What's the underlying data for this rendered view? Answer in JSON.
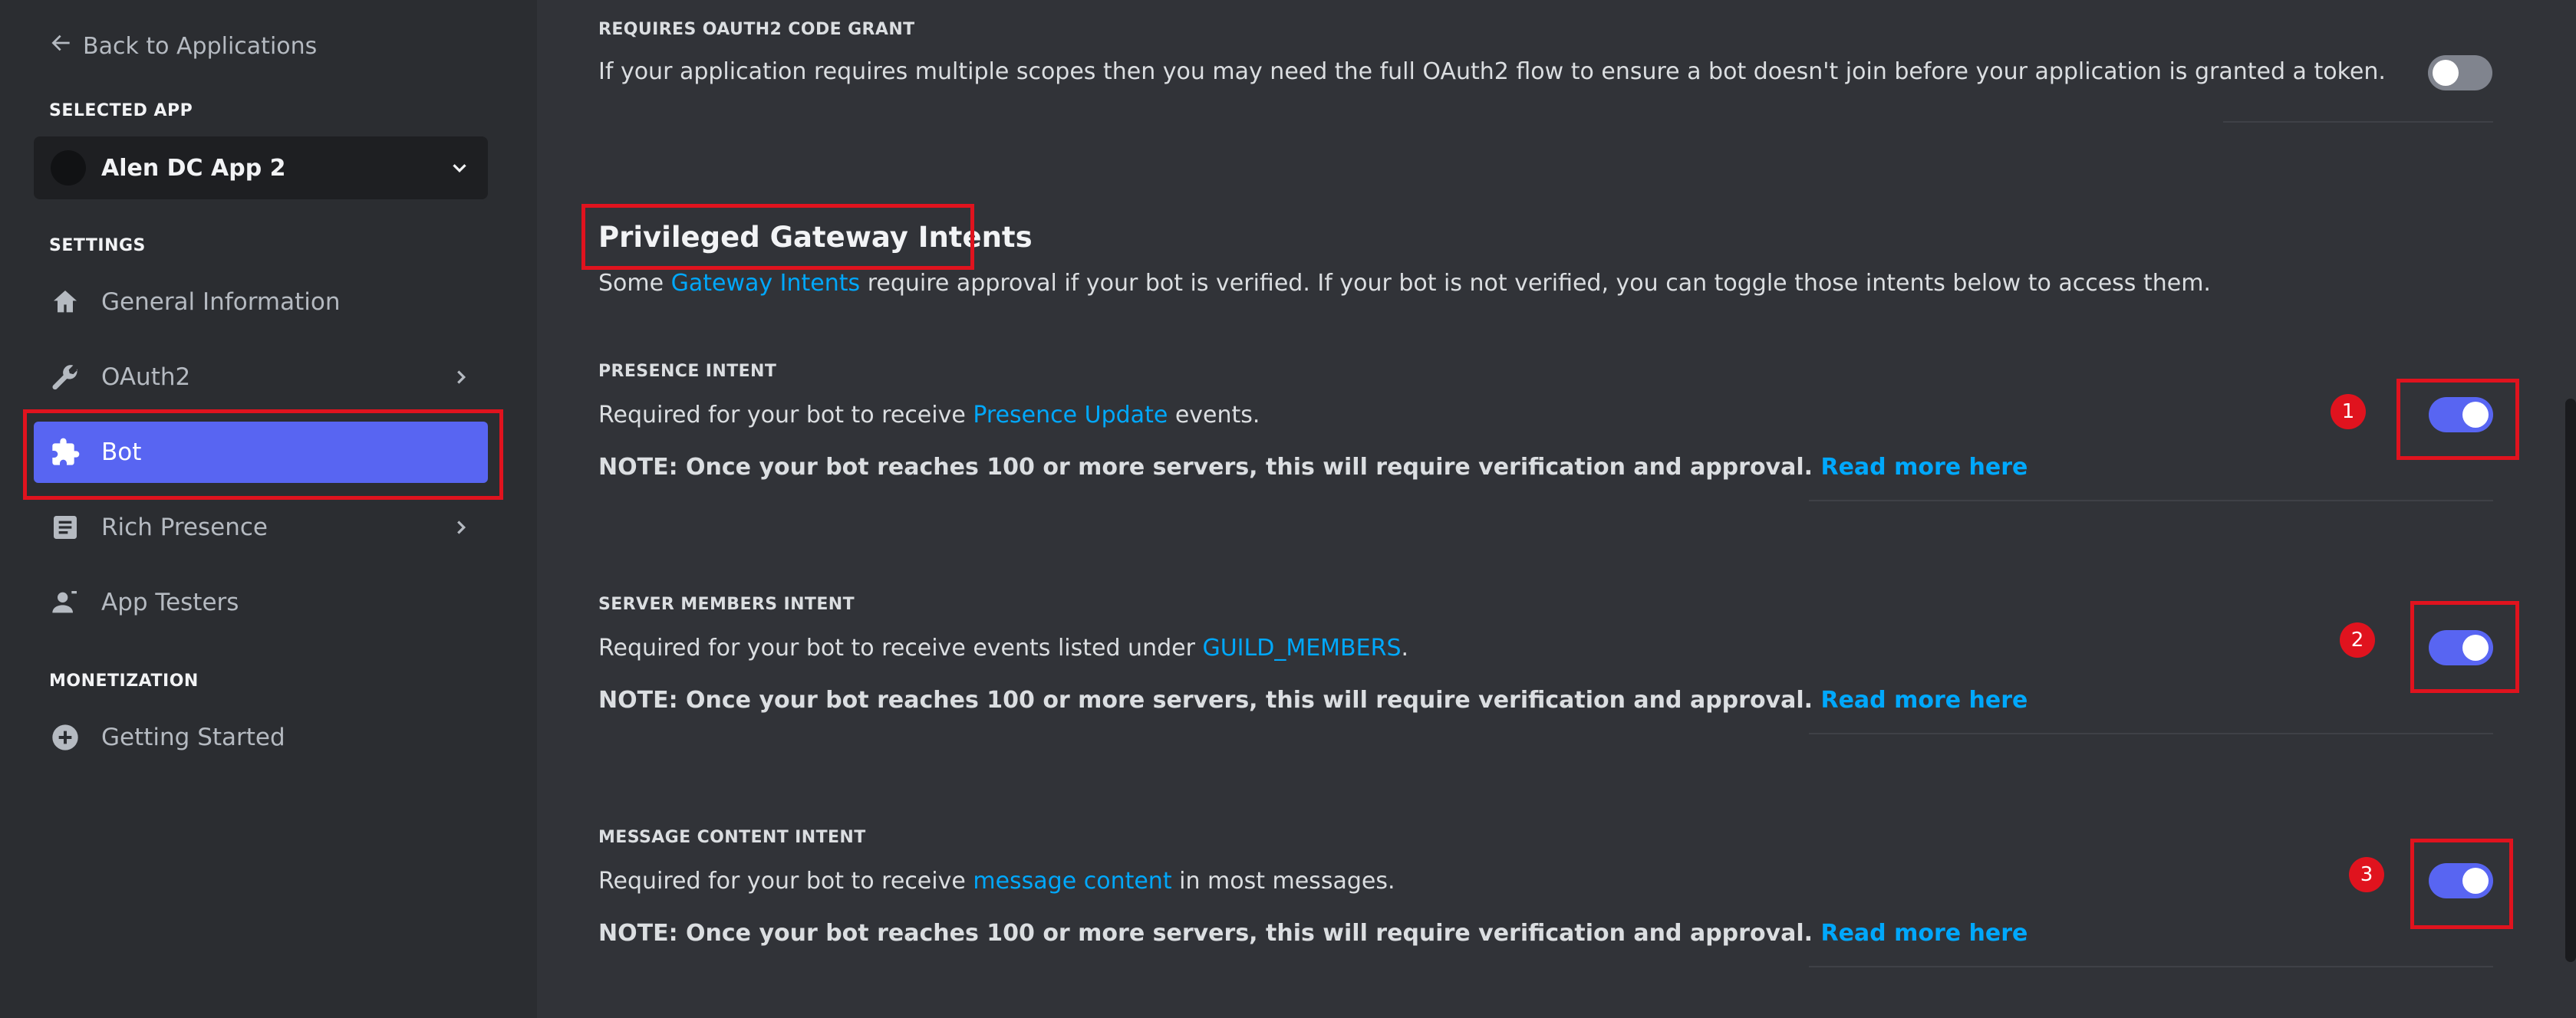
{
  "sidebar": {
    "back_label": "Back to Applications",
    "selected_app_label": "SELECTED APP",
    "app_name": "Alen DC App 2",
    "settings_label": "SETTINGS",
    "items": [
      {
        "label": "General Information",
        "icon": "home-icon"
      },
      {
        "label": "OAuth2",
        "icon": "wrench-icon"
      },
      {
        "label": "Bot",
        "icon": "puzzle-icon"
      },
      {
        "label": "Rich Presence",
        "icon": "document-icon"
      },
      {
        "label": "App Testers",
        "icon": "user-icon"
      }
    ],
    "monetization_label": "MONETIZATION",
    "monetization_items": [
      {
        "label": "Getting Started",
        "icon": "plus-circle-icon"
      }
    ]
  },
  "main": {
    "oauth_grant": {
      "title": "REQUIRES OAUTH2 CODE GRANT",
      "description": "If your application requires multiple scopes then you may need the full OAuth2 flow to ensure a bot doesn't join before your application is granted a token.",
      "enabled": false
    },
    "intents_section": {
      "heading": "Privileged Gateway Intents",
      "desc_prefix": "Some ",
      "desc_link": "Gateway Intents",
      "desc_suffix": " require approval if your bot is verified. If your bot is not verified, you can toggle those intents below to access them."
    },
    "intents": [
      {
        "title": "PRESENCE INTENT",
        "desc_prefix": "Required for your bot to receive ",
        "desc_link": "Presence Update",
        "desc_suffix": " events.",
        "note": "NOTE: Once your bot reaches 100 or more servers, this will require verification and approval.",
        "note_link": "Read more here",
        "enabled": true,
        "badge": "1"
      },
      {
        "title": "SERVER MEMBERS INTENT",
        "desc_prefix": "Required for your bot to receive events listed under ",
        "desc_link": "GUILD_MEMBERS",
        "desc_suffix": ".",
        "note": "NOTE: Once your bot reaches 100 or more servers, this will require verification and approval.",
        "note_link": "Read more here",
        "enabled": true,
        "badge": "2"
      },
      {
        "title": "MESSAGE CONTENT INTENT",
        "desc_prefix": "Required for your bot to receive ",
        "desc_link": "message content",
        "desc_suffix": " in most messages.",
        "note": "NOTE: Once your bot reaches 100 or more servers, this will require verification and approval.",
        "note_link": "Read more here",
        "enabled": true,
        "badge": "3"
      }
    ]
  },
  "colors": {
    "sidebar_bg": "#2b2d31",
    "main_bg": "#313338",
    "accent": "#5865f2",
    "link": "#00a8fc",
    "annotation_red": "#e0131e"
  }
}
